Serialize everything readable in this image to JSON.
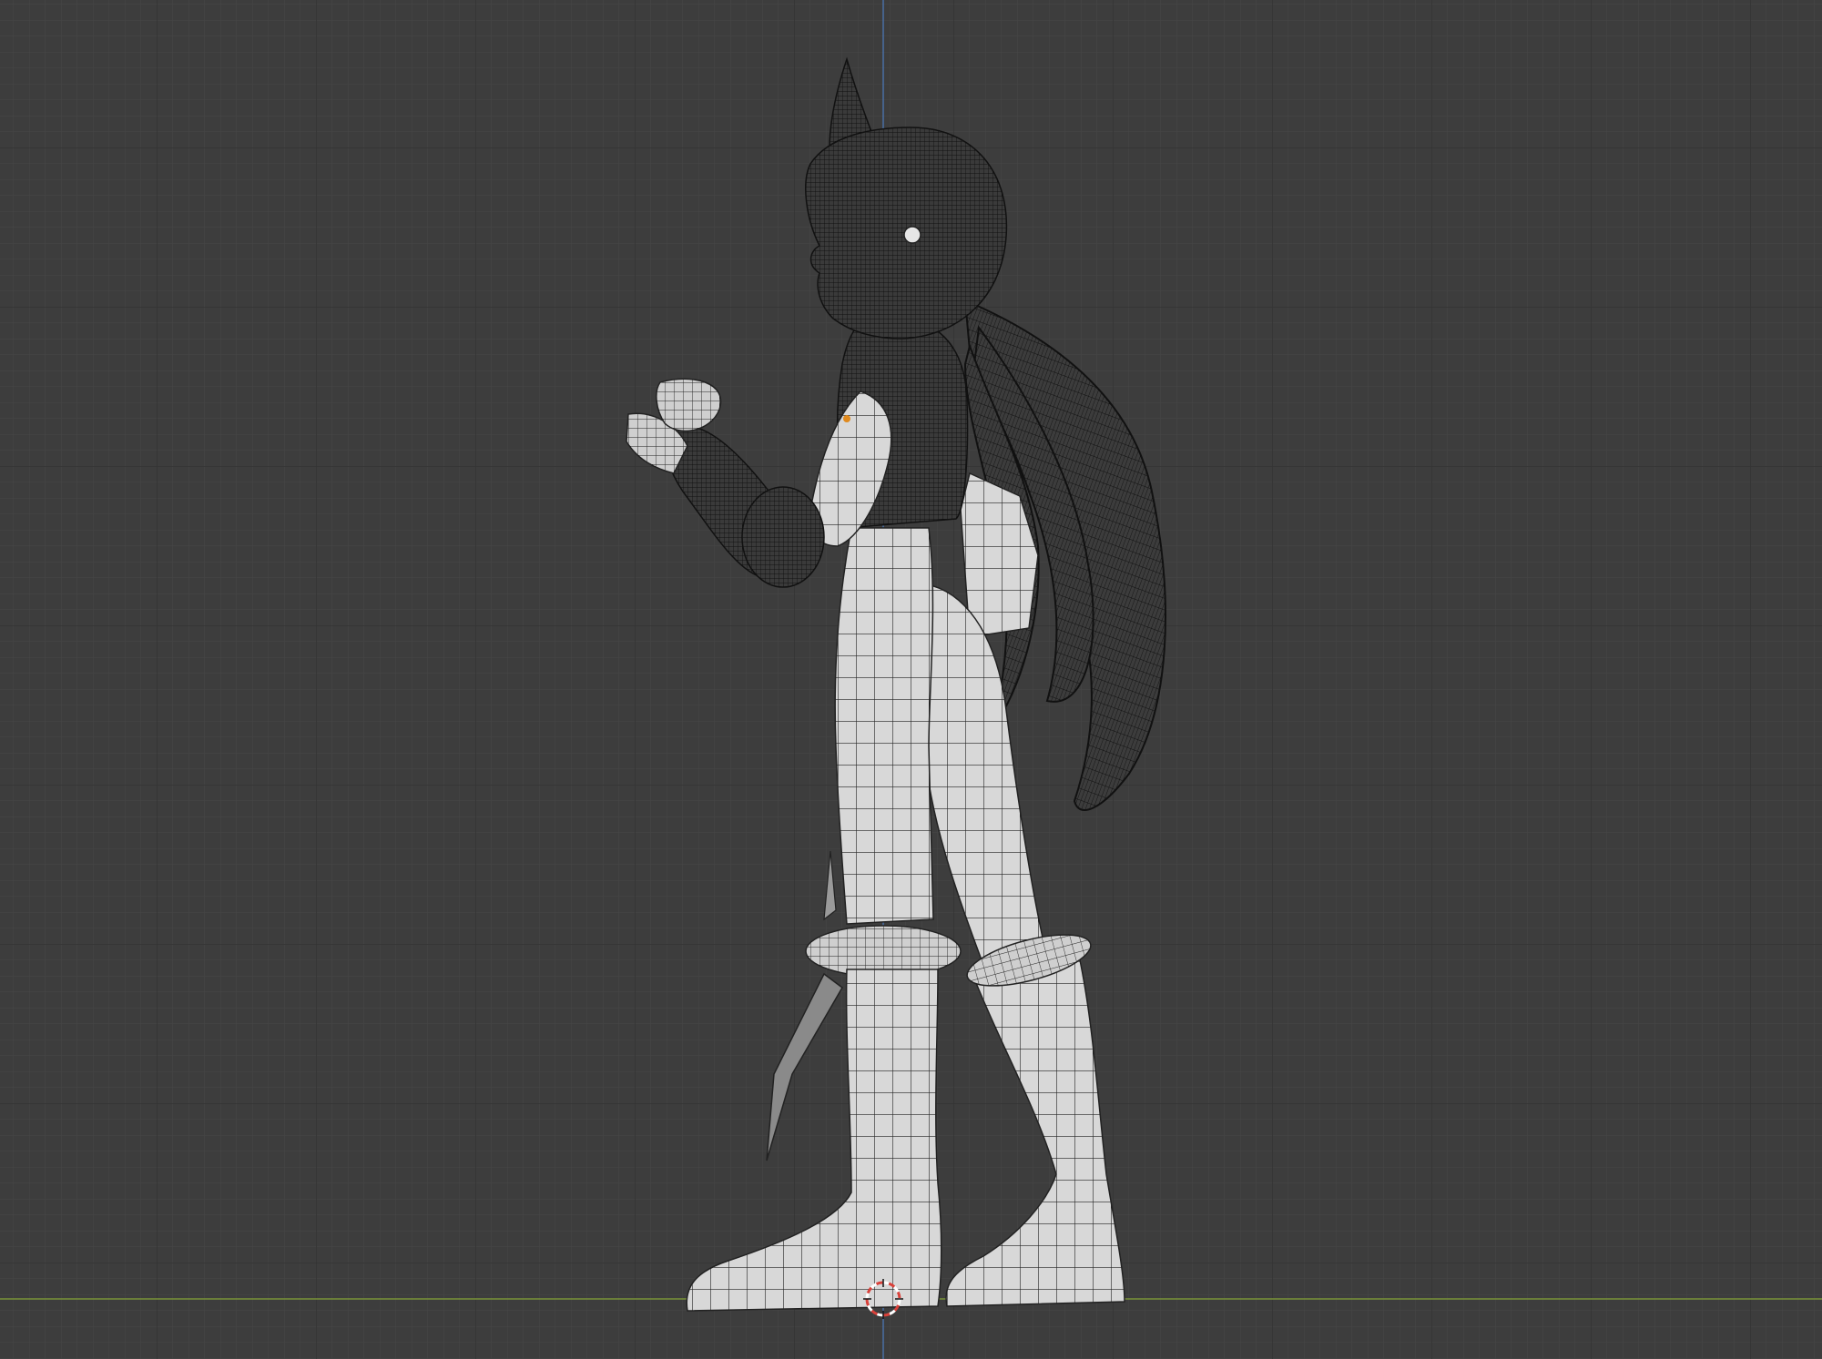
{
  "viewport": {
    "background_color": "#3d3d3d",
    "minor_grid_color": "#474747",
    "major_grid_color": "#333333",
    "z_axis_color": "#4a6fa3",
    "x_axis_color": "#7a9438",
    "cursor_color": "#d9413a"
  },
  "scene": {
    "object": "character-mesh",
    "view": "side-orthographic",
    "shading": "solid-with-wireframe",
    "light_mesh_color": "#d8d8d8",
    "dark_mesh_color": "#2b2b2b",
    "wire_color": "#1e1e1e",
    "origin_marker_color": "#e08a1e"
  }
}
